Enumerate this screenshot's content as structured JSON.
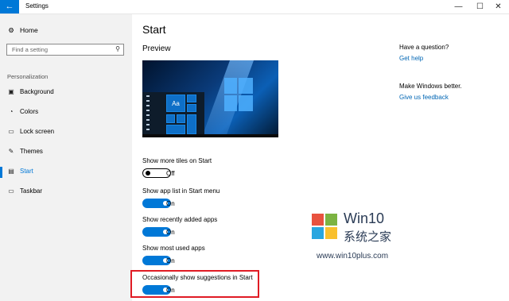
{
  "window": {
    "title": "Settings",
    "back_icon": "←",
    "minimize": "—",
    "maximize": "☐",
    "close": "✕"
  },
  "sidebar": {
    "home_label": "Home",
    "home_icon": "⚙",
    "search_placeholder": "Find a setting",
    "search_icon": "⚲",
    "section": "Personalization",
    "items": [
      {
        "label": "Background",
        "icon": "▣",
        "active": false
      },
      {
        "label": "Colors",
        "icon": "◔",
        "active": false
      },
      {
        "label": "Lock screen",
        "icon": "▭",
        "active": false
      },
      {
        "label": "Themes",
        "icon": "✎",
        "active": false
      },
      {
        "label": "Start",
        "icon": "▤",
        "active": true
      },
      {
        "label": "Taskbar",
        "icon": "▭",
        "active": false
      }
    ]
  },
  "main": {
    "title": "Start",
    "preview_title": "Preview",
    "preview_tile_text": "Aa",
    "settings": [
      {
        "label": "Show more tiles on Start",
        "state": "Off",
        "on": false
      },
      {
        "label": "Show app list in Start menu",
        "state": "On",
        "on": true
      },
      {
        "label": "Show recently added apps",
        "state": "On",
        "on": true
      },
      {
        "label": "Show most used apps",
        "state": "On",
        "on": true
      },
      {
        "label": "Occasionally show suggestions in Start",
        "state": "On",
        "on": true
      }
    ]
  },
  "help": {
    "question": "Have a question?",
    "get_help": "Get help",
    "better": "Make Windows better.",
    "feedback": "Give us feedback"
  },
  "watermark": {
    "title": "Win10",
    "cn": "系统之家",
    "url": "www.win10plus.com"
  },
  "colors": {
    "accent": "#0078d7",
    "highlight": "#e01b24",
    "link": "#0066b4"
  }
}
